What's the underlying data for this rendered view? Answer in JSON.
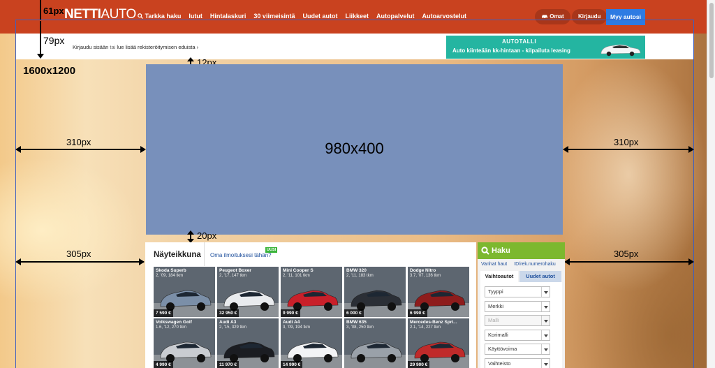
{
  "header": {
    "logo_bold": "NETTI",
    "logo_thin": "AUTO",
    "nav": [
      "Tarkka haku",
      "Iutut",
      "Hintalaskuri",
      "30 viimeisintä",
      "Uudet autot",
      "Liikkeet",
      "Autopalvelut",
      "Autoarvostelut"
    ],
    "omat": "Omat",
    "kirjaudu": "Kirjaudu",
    "sell": "Myy autosi",
    "colors": {
      "bar": "#c9421f",
      "sell": "#2d7be3"
    }
  },
  "subbar": {
    "login_a": "Kirjaudu sisään",
    "login_or": "tai",
    "login_b": "lue lisää rekisteröitymisen eduista",
    "promo_brand": "AUTOTALLI",
    "promo_text": "Auto kiinteään kk-hintaan - kilpailuta leasing"
  },
  "annotations": {
    "top_61": "61px",
    "top_79": "79px",
    "page_size": "1600x1200",
    "gap_12": "12px",
    "left_310": "310px",
    "right_310": "310px",
    "banner_size": "980x400",
    "gap_20": "20px",
    "left_305": "305px",
    "right_305": "305px"
  },
  "showroom": {
    "title": "Näyteikkuna",
    "link": "Oma ilmoituksesi tähän?",
    "badge": "UUSI",
    "cars": [
      {
        "name": "Skoda Superb",
        "info": "2, '09, 184 tkm",
        "price": "7 590 €",
        "color": "#7b8fa8"
      },
      {
        "name": "Peugeot Boxer",
        "info": "2, '17, 147 tkm",
        "price": "32 950 €",
        "color": "#e9ebee"
      },
      {
        "name": "Mini Cooper S",
        "info": "2, '11, 101 tkm",
        "price": "9 990 €",
        "color": "#c9202a"
      },
      {
        "name": "BMW 320",
        "info": "2, '11, 183 tkm",
        "price": "6 000 €",
        "color": "#2b2f36"
      },
      {
        "name": "Dodge Nitro",
        "info": "3.7, '07, 136 tkm",
        "price": "6 990 €",
        "color": "#8e1c1c"
      },
      {
        "name": "Volkswagen Golf",
        "info": "1.6, '12, 270 tkm",
        "price": "4 990 €",
        "color": "#c9ccd1"
      },
      {
        "name": "Audi A3",
        "info": "2, '15, 329 tkm",
        "price": "11 970 €",
        "color": "#1b1d22"
      },
      {
        "name": "Audi A4",
        "info": "3, '09, 194 tkm",
        "price": "14 990 €",
        "color": "#f2f3f5"
      },
      {
        "name": "BMW 635",
        "info": "3, '08, 250 tkm",
        "price": "",
        "color": "#9aa1a9"
      },
      {
        "name": "Mercedes-Benz Spri...",
        "info": "2.1, '14, 227 tkm",
        "price": "29 900 €",
        "color": "#c02a2a"
      }
    ]
  },
  "search": {
    "title": "Haku",
    "link_a": "Vanhat haut",
    "link_b": "ID/rek.numerohaku",
    "tab_active": "Vaihtoautot",
    "tab_other": "Uudet autot",
    "selects": [
      {
        "label": "Tyyppi",
        "disabled": false
      },
      {
        "label": "Merkki",
        "disabled": false
      },
      {
        "label": "Malli",
        "disabled": true
      },
      {
        "label": "Korimalli",
        "disabled": false
      },
      {
        "label": "Käyttövoima",
        "disabled": false
      },
      {
        "label": "Vaihteisto",
        "disabled": false
      }
    ]
  }
}
